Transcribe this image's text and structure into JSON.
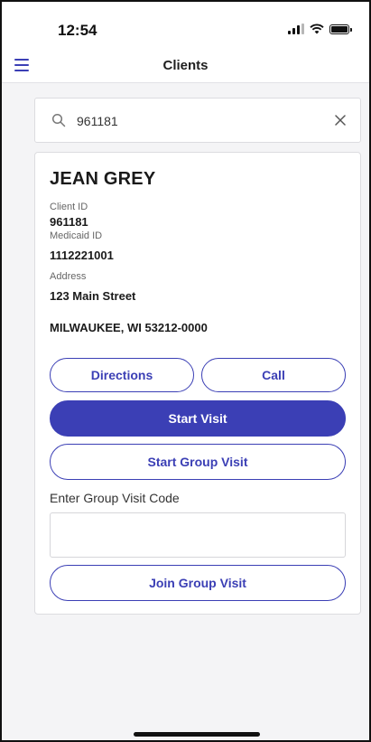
{
  "status_bar": {
    "time": "12:54"
  },
  "nav": {
    "title": "Clients"
  },
  "search": {
    "value": "961181"
  },
  "client": {
    "name": "JEAN GREY",
    "client_id_label": "Client ID",
    "client_id": "961181",
    "medicaid_id_label": "Medicaid ID",
    "medicaid_id": "1112221001",
    "address_label": "Address",
    "address_line1": "123 Main Street",
    "address_line2": "MILWAUKEE, WI 53212-0000"
  },
  "actions": {
    "directions": "Directions",
    "call": "Call",
    "start_visit": "Start Visit",
    "start_group_visit": "Start Group Visit",
    "group_code_label": "Enter Group Visit Code",
    "join_group_visit": "Join Group Visit"
  },
  "colors": {
    "accent": "#3b3fb5",
    "background": "#f4f4f6"
  }
}
